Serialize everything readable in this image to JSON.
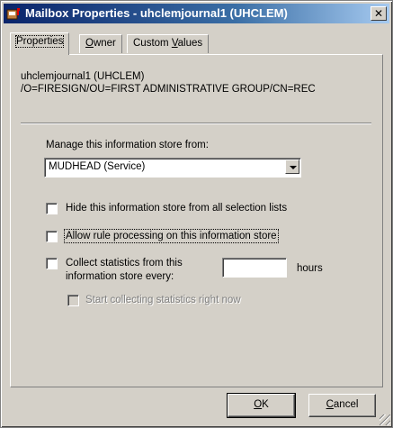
{
  "window": {
    "title": "Mailbox Properties - uhclemjournal1 (UHCLEM)",
    "close_glyph": "✕",
    "icon": "mailbox-icon"
  },
  "tabs": [
    {
      "label_pre": "P",
      "label_rest": "roperties",
      "label": "Properties",
      "active": true
    },
    {
      "label_pre": "",
      "label_u": "O",
      "label_rest": "wner",
      "label": "Owner",
      "active": false
    },
    {
      "label_pre": "Custom ",
      "label_u": "V",
      "label_rest": "alues",
      "label": "Custom Values",
      "active": false
    }
  ],
  "mailbox": {
    "name": "uhclemjournal1 (UHCLEM)",
    "dn": "/O=FIRESIGN/OU=FIRST ADMINISTRATIVE GROUP/CN=REC"
  },
  "manage": {
    "label": "Manage this information store from:",
    "selected": "MUDHEAD (Service)"
  },
  "checkboxes": {
    "hide": {
      "label": "Hide this information store from all selection lists",
      "checked": false
    },
    "rules": {
      "label": "Allow rule processing on this information store",
      "checked": false
    },
    "stats": {
      "label_line1": "Collect statistics from this",
      "label_line2": "information store every:",
      "checked": false
    },
    "start": {
      "label": "Start collecting statistics right now",
      "checked": false,
      "disabled": true
    }
  },
  "stats_interval": {
    "value": "",
    "unit": "hours"
  },
  "buttons": {
    "ok_u": "O",
    "ok_rest": "K",
    "cancel_u": "C",
    "cancel_rest": "ancel"
  },
  "colors": {
    "face": "#d4d0c8",
    "title_start": "#0a246a",
    "title_end": "#a6caf0"
  }
}
